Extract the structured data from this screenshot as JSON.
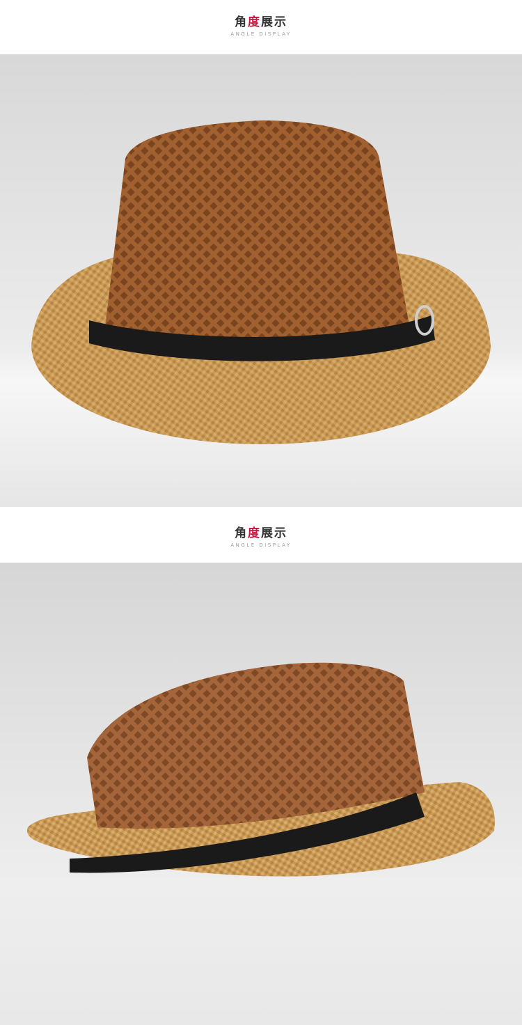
{
  "sections": [
    {
      "title_cn_pre": "角",
      "title_cn_accent": "度",
      "title_cn_post": "展示",
      "title_en": "ANGLE DISPLAY",
      "photo_alt": "front-view-hat-photo"
    },
    {
      "title_cn_pre": "角",
      "title_cn_accent": "度",
      "title_cn_post": "展示",
      "title_en": "ANGLE DISPLAY",
      "photo_alt": "side-view-hat-photo"
    }
  ],
  "colors": {
    "accent": "#c8163d",
    "crown_mesh": "#a8683a",
    "brim_straw": "#c99a55",
    "band": "#1a1a1a",
    "background_gray": "#dcdcdc"
  }
}
